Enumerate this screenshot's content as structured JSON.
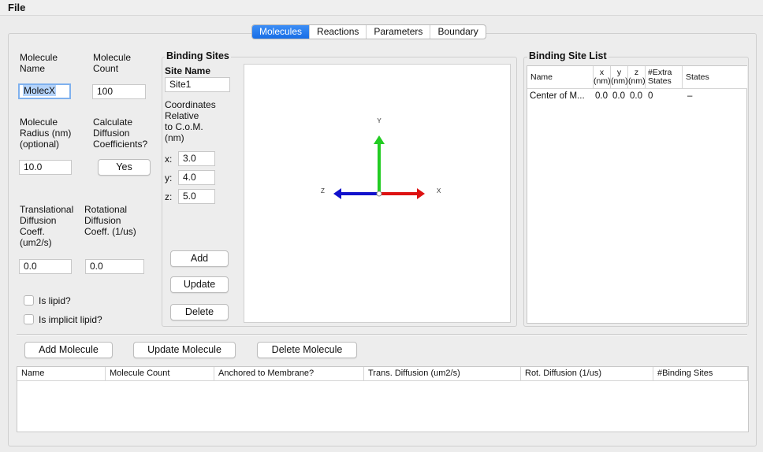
{
  "menubar": {
    "file": "File"
  },
  "tabs": [
    "Molecules",
    "Reactions",
    "Parameters",
    "Boundary"
  ],
  "molecule": {
    "name_label": "Molecule\nName",
    "name_value": "MolecX",
    "count_label": "Molecule\nCount",
    "count_value": "100",
    "radius_label": "Molecule\nRadius (nm)\n(optional)",
    "radius_value": "10.0",
    "calc_label": "Calculate\nDiffusion\nCoefficients?",
    "calc_button": "Yes",
    "trans_label": "Translational\nDiffusion\nCoeff.\n(um2/s)",
    "trans_value": "0.0",
    "rot_label": "Rotational\nDiffusion\nCoeff. (1/us)",
    "rot_value": "0.0",
    "is_lipid": "Is lipid?",
    "is_implicit_lipid": "Is implicit lipid?"
  },
  "binding_sites": {
    "title": "Binding Sites",
    "site_name_label": "Site Name",
    "site_name_value": "Site1",
    "coords_label": "Coordinates\nRelative\nto C.o.M.\n(nm)",
    "x_label": "x:",
    "x_value": "3.0",
    "y_label": "y:",
    "y_value": "4.0",
    "z_label": "z:",
    "z_value": "5.0",
    "add": "Add",
    "update": "Update",
    "delete": "Delete"
  },
  "axes": {
    "x": "X",
    "y": "Y",
    "z": "Z",
    "colors": {
      "x": "#dd1111",
      "y": "#22cc22",
      "z": "#1111cc"
    }
  },
  "site_list": {
    "title": "Binding Site List",
    "headers": [
      "Name",
      "x\n(nm)",
      "y\n(nm)",
      "z\n(nm)",
      "#Extra\nStates",
      "States"
    ],
    "rows": [
      [
        "Center of M...",
        "0.0",
        "0.0",
        "0.0",
        "0",
        "–"
      ]
    ]
  },
  "actions": {
    "add": "Add Molecule",
    "update": "Update Molecule",
    "delete": "Delete Molecule"
  },
  "molecule_table": {
    "headers": [
      "Name",
      "Molecule Count",
      "Anchored to Membrane?",
      "Trans. Diffusion (um2/s)",
      "Rot. Diffusion (1/us)",
      "#Binding Sites"
    ]
  },
  "accent_color": "#1a73e8"
}
